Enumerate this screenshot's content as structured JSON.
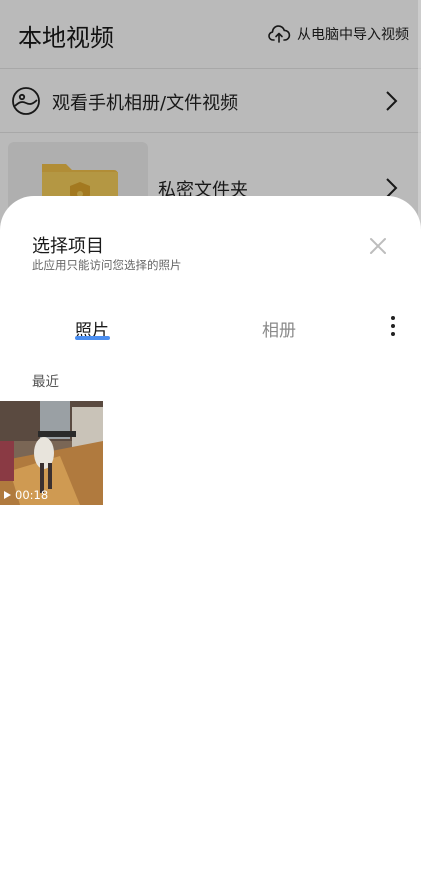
{
  "app": {
    "title": "本地视频",
    "import_label": "从电脑中导入视频",
    "watch_row": "观看手机相册/文件视频",
    "private_folder": "私密文件夹"
  },
  "sheet": {
    "title": "选择项目",
    "subtitle": "此应用只能访问您选择的照片",
    "tabs": [
      {
        "label": "照片",
        "active": true
      },
      {
        "label": "相册",
        "active": false
      }
    ],
    "section_label": "最近",
    "items": [
      {
        "type": "video",
        "duration": "00:18"
      }
    ]
  },
  "colors": {
    "accent": "#4a8ef0",
    "folder": "#f3c24a",
    "scrim": "rgba(0,0,0,0.27)"
  },
  "icons": [
    "cloud-upload-icon",
    "photo-circle-icon",
    "chevron-right-icon",
    "folder-icon",
    "close-icon",
    "more-vert-icon",
    "play-icon"
  ]
}
